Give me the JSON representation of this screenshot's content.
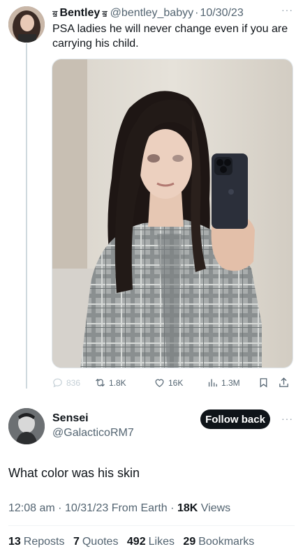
{
  "tweet": {
    "name_prefix_glyph": "ॿ",
    "name": "Bentley",
    "name_suffix_glyph": "ॿ",
    "handle": "@bentley_babyy",
    "separator": "·",
    "date": "10/30/23",
    "more": "···",
    "text": "PSA ladies he will never change even if you are carrying his child.",
    "actions": {
      "replies": "836",
      "retweets": "1.8K",
      "likes": "16K",
      "views": "1.3M"
    }
  },
  "reply": {
    "name": "Sensei",
    "handle": "@GalacticoRM7",
    "follow_label": "Follow back",
    "more": "···",
    "text": "What color was his skin",
    "time": "12:08 am",
    "sep1": "·",
    "date": "10/31/23",
    "source": "From Earth",
    "sep2": "·",
    "views_count": "18K",
    "views_label": "Views",
    "stats": {
      "reposts_count": "13",
      "reposts_label": "Reposts",
      "quotes_count": "7",
      "quotes_label": "Quotes",
      "likes_count": "492",
      "likes_label": "Likes",
      "bookmarks_count": "29",
      "bookmarks_label": "Bookmarks"
    }
  },
  "colors": {
    "text_primary": "#0f1419",
    "text_secondary": "#536471",
    "button_bg": "#0f1419",
    "thread_line": "#cfd9de"
  },
  "icons": [
    "reply-icon",
    "retweet-icon",
    "like-icon",
    "views-icon",
    "bookmark-icon",
    "share-icon"
  ]
}
